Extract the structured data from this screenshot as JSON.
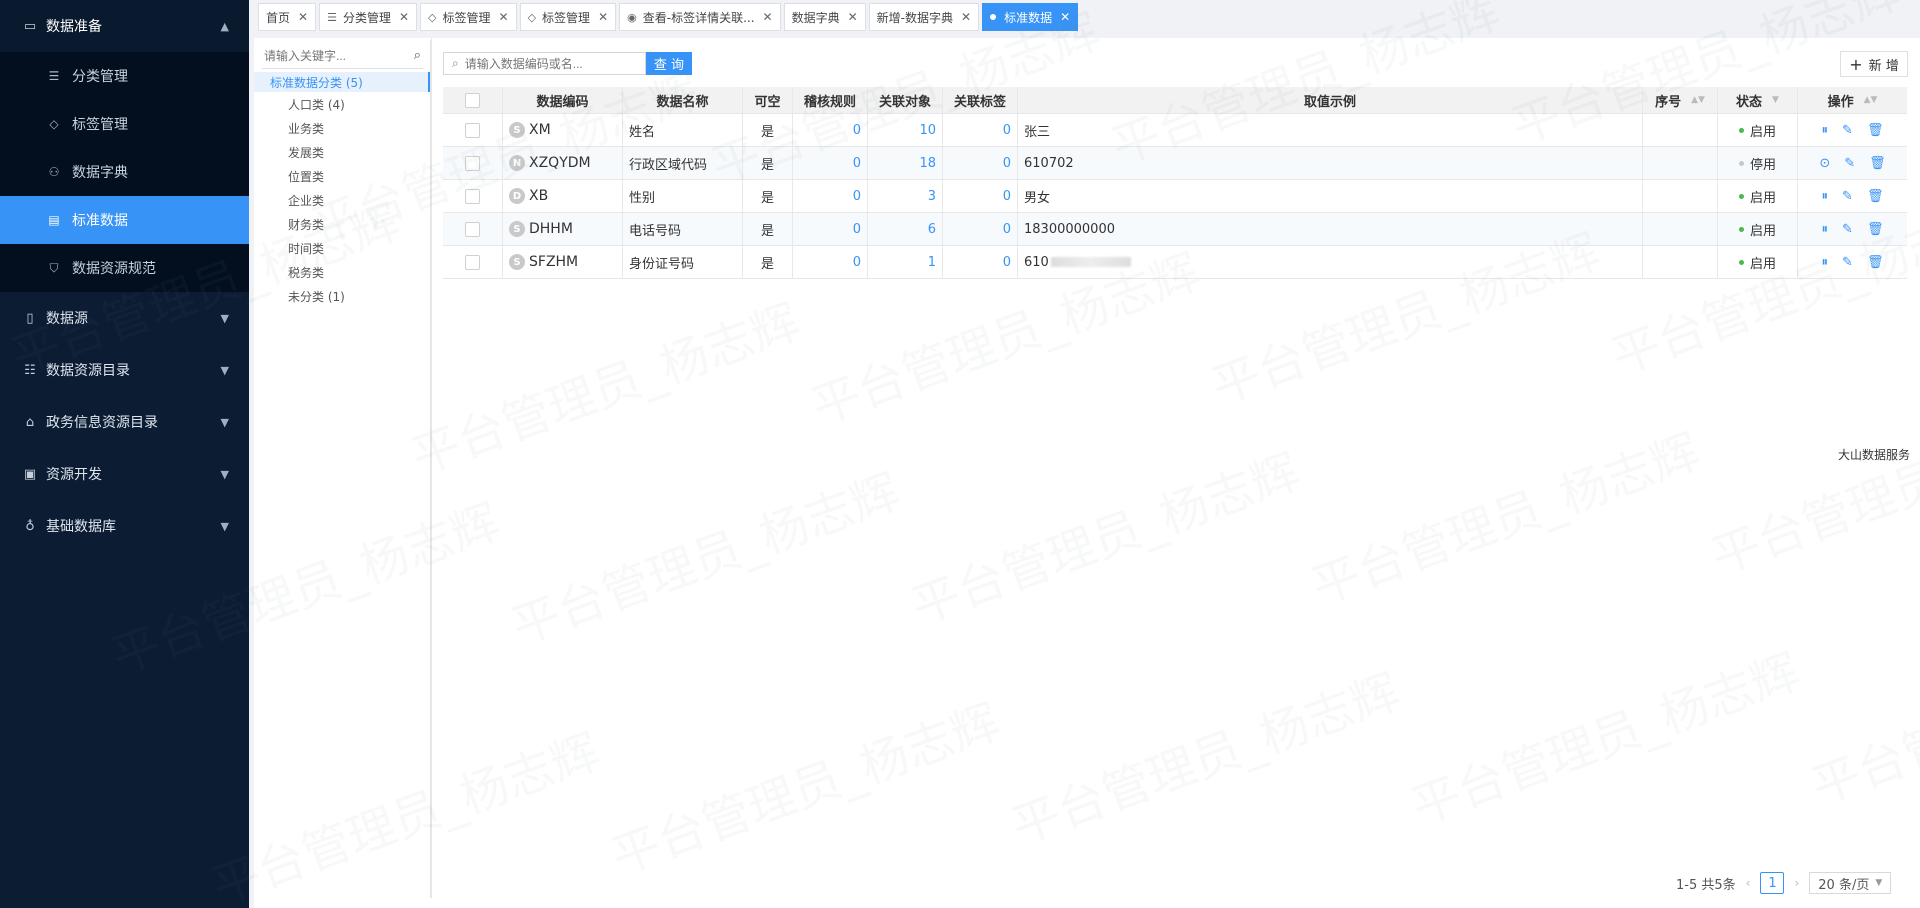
{
  "sidebar": {
    "group_open": {
      "label": "数据准备",
      "icon": "briefcase-icon"
    },
    "subitems": [
      {
        "label": "分类管理",
        "icon": "list-icon"
      },
      {
        "label": "标签管理",
        "icon": "tag-icon"
      },
      {
        "label": "数据字典",
        "icon": "network-icon"
      },
      {
        "label": "标准数据",
        "icon": "document-icon",
        "active": true
      },
      {
        "label": "数据资源规范",
        "icon": "shield-icon"
      }
    ],
    "groups": [
      {
        "label": "数据源",
        "icon": "database-icon"
      },
      {
        "label": "数据资源目录",
        "icon": "catalog-icon"
      },
      {
        "label": "政务信息资源目录",
        "icon": "bank-icon"
      },
      {
        "label": "资源开发",
        "icon": "terminal-icon"
      },
      {
        "label": "基础数据库",
        "icon": "hierarchy-icon"
      }
    ]
  },
  "tabs": [
    {
      "label": "首页",
      "icon": ""
    },
    {
      "label": "分类管理",
      "icon": "list-icon"
    },
    {
      "label": "标签管理",
      "icon": "tag-icon"
    },
    {
      "label": "标签管理",
      "icon": "tag-icon"
    },
    {
      "label": "查看-标签详情关联...",
      "icon": "eye-icon"
    },
    {
      "label": "数据字典",
      "icon": ""
    },
    {
      "label": "新增-数据字典",
      "icon": ""
    },
    {
      "label": "标准数据",
      "icon": "dot",
      "active": true
    }
  ],
  "tree": {
    "search_placeholder": "请输入关键字...",
    "root": "标准数据分类 (5)",
    "nodes": [
      "人口类 (4)",
      "业务类",
      "发展类",
      "位置类",
      "企业类",
      "财务类",
      "时间类",
      "税务类",
      "未分类 (1)"
    ]
  },
  "toolbar": {
    "search_placeholder": "请输入数据编码或名...",
    "query_label": "查 询",
    "add_label": "新 增"
  },
  "table": {
    "headers": {
      "code": "数据编码",
      "name": "数据名称",
      "nullable": "可空",
      "rules": "稽核规则",
      "objects": "关联对象",
      "tags": "关联标签",
      "example": "取值示例",
      "seq": "序号",
      "status": "状态",
      "ops": "操作"
    },
    "rows": [
      {
        "type": "S",
        "code": "XM",
        "name": "姓名",
        "nullable": "是",
        "rules": "0",
        "objects": "10",
        "tags": "0",
        "example": "张三",
        "status": "启用",
        "enabled": true
      },
      {
        "type": "N",
        "code": "XZQYDM",
        "name": "行政区域代码",
        "nullable": "是",
        "rules": "0",
        "objects": "18",
        "tags": "0",
        "example": "610702",
        "status": "停用",
        "enabled": false
      },
      {
        "type": "D",
        "code": "XB",
        "name": "性别",
        "nullable": "是",
        "rules": "0",
        "objects": "3",
        "tags": "0",
        "example": "男女",
        "status": "启用",
        "enabled": true
      },
      {
        "type": "S",
        "code": "DHHM",
        "name": "电话号码",
        "nullable": "是",
        "rules": "0",
        "objects": "6",
        "tags": "0",
        "example": "18300000000",
        "status": "启用",
        "enabled": true
      },
      {
        "type": "S",
        "code": "SFZHM",
        "name": "身份证号码",
        "nullable": "是",
        "rules": "0",
        "objects": "1",
        "tags": "0",
        "example": "610",
        "status": "启用",
        "enabled": true
      }
    ]
  },
  "side_note": "大山数据服务",
  "pager": {
    "summary": "1-5 共5条",
    "page": "1",
    "size": "20 条/页"
  },
  "watermark": "平台管理员_杨志辉",
  "colors": {
    "accent": "#3793f5",
    "sidebar_bg": "#0b1c33",
    "sidebar_sub_bg": "#030f1f",
    "enabled": "#4cb84c"
  }
}
